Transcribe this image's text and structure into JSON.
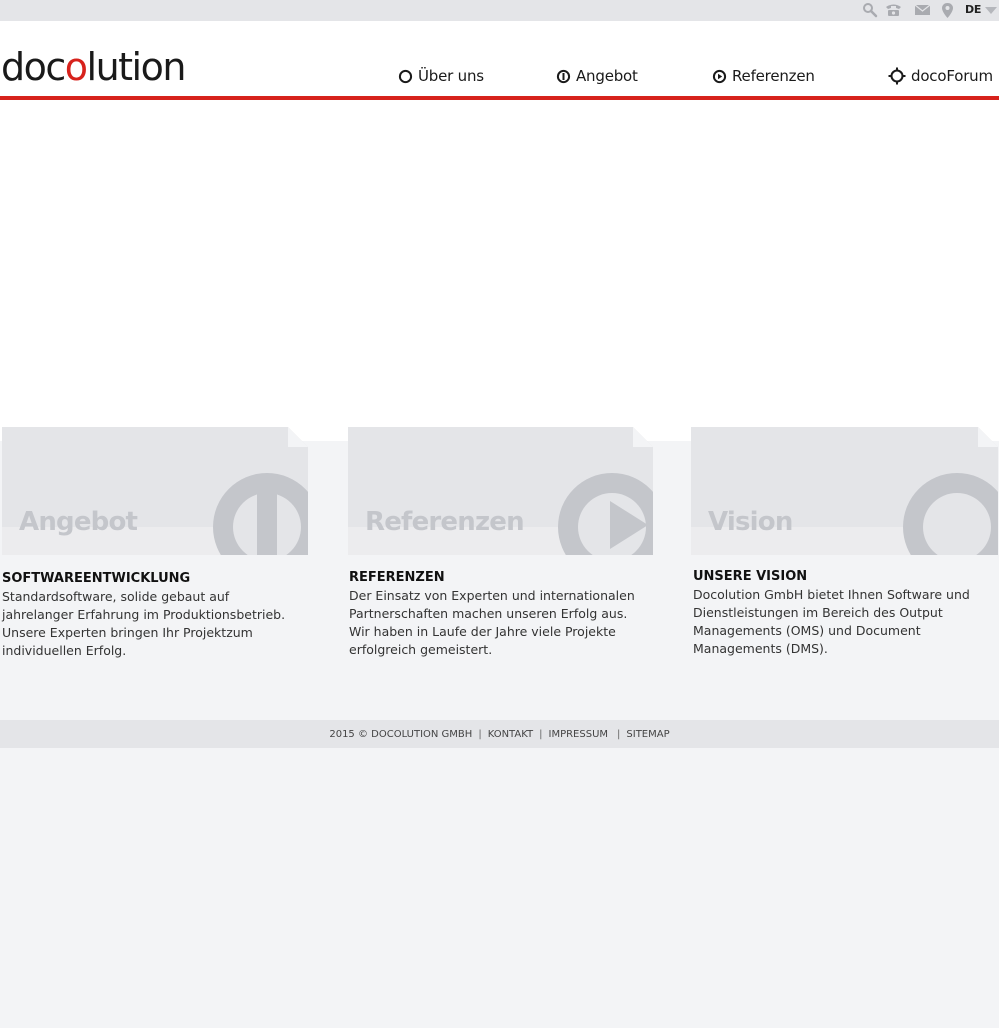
{
  "topbar": {
    "icons": [
      "search-icon",
      "phone-icon",
      "mail-icon",
      "location-pin-icon"
    ],
    "language": "DE"
  },
  "logo": {
    "part1": "doc",
    "part2": "o",
    "part3": "lution"
  },
  "nav": [
    {
      "label": "Über uns",
      "icon": "circle-icon"
    },
    {
      "label": "Angebot",
      "icon": "power-icon"
    },
    {
      "label": "Referenzen",
      "icon": "play-icon"
    },
    {
      "label": "docoForum",
      "icon": "target-icon"
    }
  ],
  "cards": [
    {
      "title": "Angebot",
      "heading": "SOFTWAREENTWICKLUNG",
      "text": "Standardsoftware, solide gebaut auf jahrelanger Erfahrung im Produktionsbetrieb. Unsere Experten bringen Ihr Projektzum individuellen Erfolg."
    },
    {
      "title": "Referenzen",
      "heading": "REFERENZEN",
      "text": "Der Einsatz von Experten und internationalen Partnerschaften machen unseren Erfolg aus. Wir haben in Laufe der Jahre viele Projekte erfolgreich gemeistert."
    },
    {
      "title": "Vision",
      "heading": "UNSERE VISION",
      "text": "Docolution GmbH bietet Ihnen Software und Dienstleistungen im Bereich des Output Managements (OMS) und Document Managements (DMS)."
    }
  ],
  "footer": {
    "copyright": "2015 © DOCOLUTION GMBH",
    "links": [
      "KONTAKT",
      "IMPRESSUM",
      "SITEMAP"
    ]
  },
  "colors": {
    "accent": "#d7221c",
    "card_bg": "#e4e5e8",
    "card_graphic": "#c4c6cb"
  }
}
